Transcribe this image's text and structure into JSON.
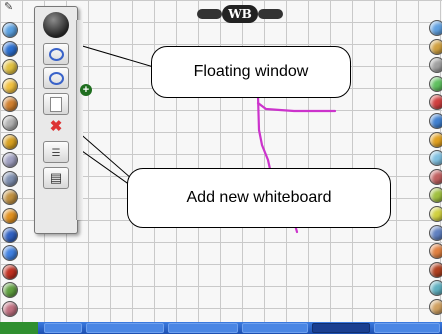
{
  "title_badge": {
    "main": "WB",
    "left_tag": "",
    "right_tag": ""
  },
  "callouts": {
    "floating_window": "Floating window",
    "add_new_whiteboard": "Add new whiteboard"
  },
  "panel_icons": [
    "sphere-icon",
    "ring-icon",
    "ring-icon",
    "page-icon",
    "close-icon",
    "lines-icon",
    "window-icon"
  ],
  "colors": {
    "pen_stroke": "#cc33cc",
    "grid": "#c9c9c9",
    "close": "#dd3333",
    "add": "#1f6e1f"
  },
  "left_toolbar_colors": [
    "#5aa0e0",
    "#2b6fd0",
    "#e0c040",
    "#f0c040",
    "#d08030",
    "#b0b0b0",
    "#d8a020",
    "#a0a0c0",
    "#8090b0",
    "#c09040",
    "#e09020",
    "#3060c0",
    "#4080e0",
    "#c03020",
    "#60a040",
    "#c07080"
  ],
  "right_toolbar_colors": [
    "#60a0e0",
    "#d0a040",
    "#a0a0a0",
    "#60c060",
    "#d04040",
    "#4080d0",
    "#e0a020",
    "#80c0e0",
    "#c06060",
    "#a0c040",
    "#d0d040",
    "#6080c0",
    "#e08040",
    "#b04020",
    "#60b0c0",
    "#d0a060"
  ]
}
